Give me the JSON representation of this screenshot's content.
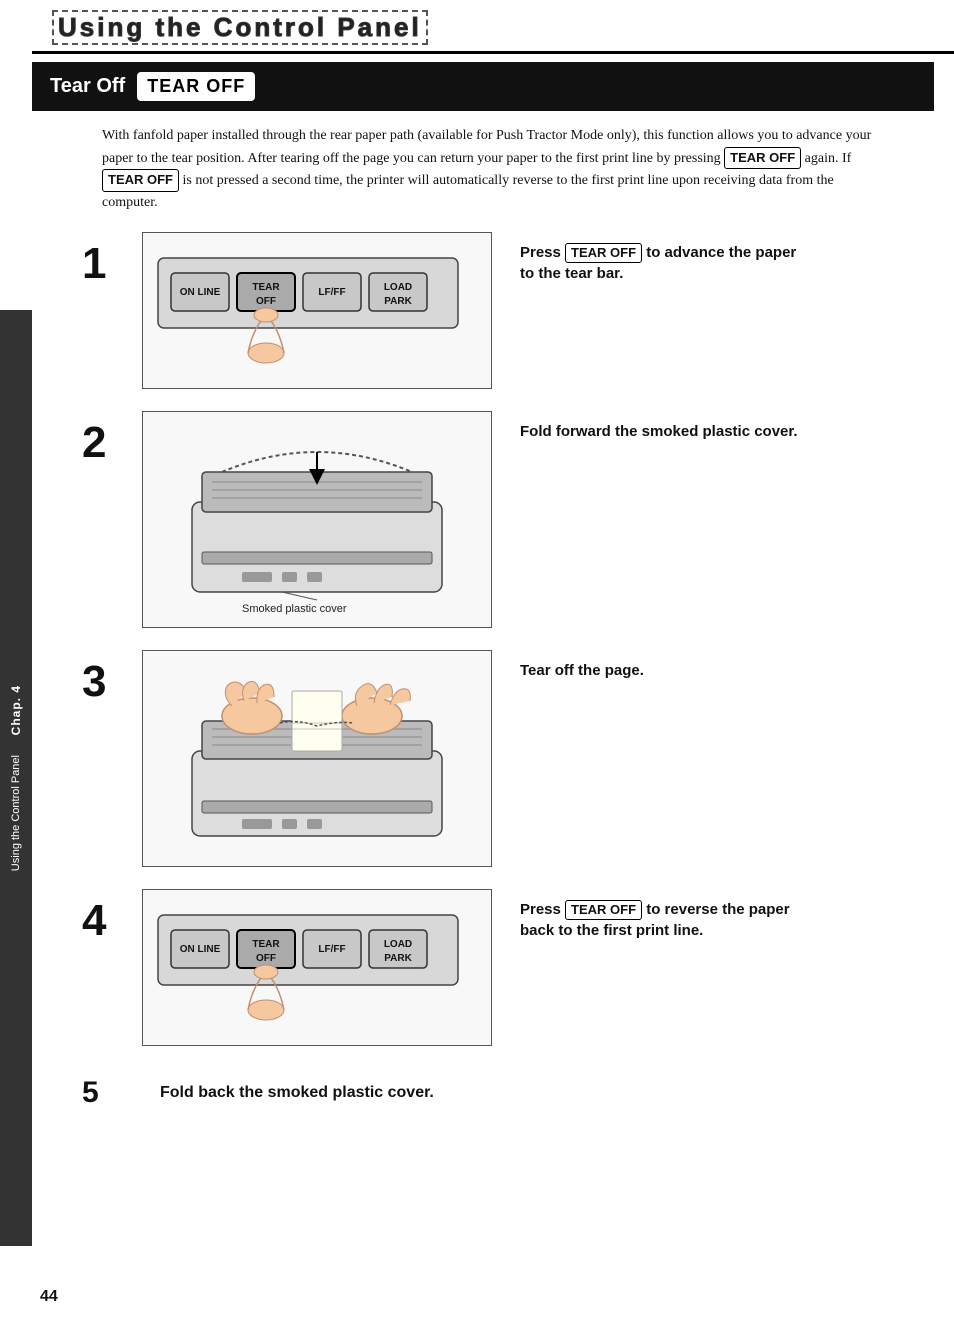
{
  "page": {
    "title": "Using the Control Panel",
    "page_number": "44"
  },
  "section": {
    "title": "Tear Off",
    "badge": "TEAR OFF"
  },
  "intro": {
    "text": "With fanfold paper installed through the rear paper path (available for Push Tractor Mode only), this function allows you to advance your paper to the tear position. After tearing off the page you can return your paper to the first print line by pressing",
    "badge1": "TEAR OFF",
    "mid_text": "again. If",
    "badge2": "TEAR OFF",
    "end_text": "is not pressed a second time, the printer will automatically reverse to the first print line upon receiving data from the computer."
  },
  "steps": [
    {
      "number": "1",
      "description": "Press",
      "badge": "TEAR OFF",
      "description2": "to advance the paper to the tear bar."
    },
    {
      "number": "2",
      "description": "Fold forward the smoked plastic cover.",
      "caption": "Smoked plastic cover"
    },
    {
      "number": "3",
      "description": "Tear off the page."
    },
    {
      "number": "4",
      "description": "Press",
      "badge": "TEAR OFF",
      "description2": "to reverse the paper back to the first print line."
    }
  ],
  "step5": {
    "number": "5",
    "description": "Fold back the smoked plastic cover."
  },
  "control_panel": {
    "buttons": [
      {
        "label": "ON LINE"
      },
      {
        "label": "TEAR\nOFF"
      },
      {
        "label": "LF/FF"
      },
      {
        "label": "LOAD\nPARK"
      }
    ]
  },
  "sidebar": {
    "chap": "Chap. 4",
    "label": "Using the Control Panel"
  }
}
